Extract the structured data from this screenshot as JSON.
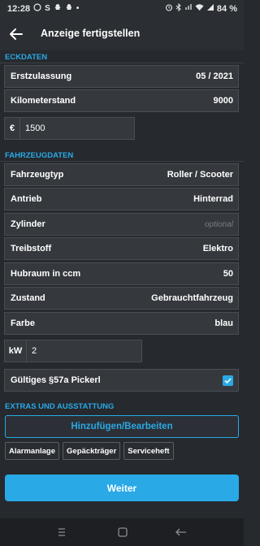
{
  "status_bar": {
    "time": "12:28",
    "battery": "84 %",
    "left_icons": [
      "whatsapp-icon",
      "s-icon",
      "snapchat-icon",
      "snapchat-icon",
      "dot-icon"
    ],
    "right_icons": [
      "alarm-icon",
      "bluetooth-icon",
      "signal-icon",
      "wifi-icon",
      "cell-signal-icon",
      "battery-icon"
    ]
  },
  "header": {
    "title": "Anzeige fertigstellen"
  },
  "eckdaten": {
    "label": "ECKDATEN",
    "erstzulassung": {
      "label": "Erstzulassung",
      "value": "05 / 2021"
    },
    "kilometerstand": {
      "label": "Kilometerstand",
      "value": "9000"
    },
    "price": {
      "currency": "€",
      "value": "1500"
    }
  },
  "fahrzeugdaten": {
    "label": "FAHRZEUGDATEN",
    "rows": [
      {
        "label": "Fahrzeugtyp",
        "value": "Roller / Scooter"
      },
      {
        "label": "Antrieb",
        "value": "Hinterrad"
      },
      {
        "label": "Zylinder",
        "placeholder": "optional"
      },
      {
        "label": "Treibstoff",
        "value": "Elektro"
      },
      {
        "label": "Hubraum in ccm",
        "value": "50"
      },
      {
        "label": "Zustand",
        "value": "Gebrauchtfahrzeug"
      },
      {
        "label": "Farbe",
        "value": "blau"
      }
    ],
    "power": {
      "unit": "kW",
      "value": "2"
    },
    "pickerl": {
      "label": "Gültiges §57a Pickerl",
      "checked": true
    }
  },
  "extras": {
    "label": "EXTRAS UND AUSSTATTUNG",
    "add_button": "Hinzufügen/Bearbeiten",
    "chips": [
      "Alarmanlage",
      "Gepäckträger",
      "Serviceheft"
    ]
  },
  "footer": {
    "next_button": "Weiter"
  },
  "colors": {
    "accent": "#29a9e6",
    "background": "#26292d",
    "row": "#35393e"
  }
}
